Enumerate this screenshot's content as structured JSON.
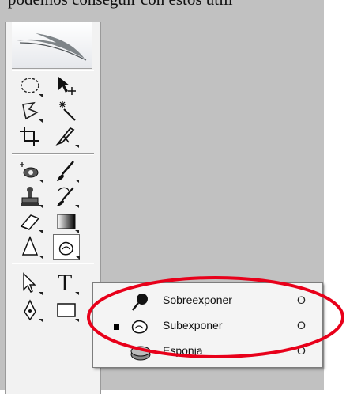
{
  "caption": "podemos conseguir con estos utili",
  "colors": {
    "workspace": "#c1c1c1",
    "toolbox": "#f2f2f2",
    "highlight_ellipse": "#e8001a"
  },
  "toolbox": {
    "tools": [
      "rectangular-marquee-icon",
      "move-icon",
      "lasso-icon",
      "magic-wand-icon",
      "crop-icon",
      "slice-icon",
      "spot-healing-icon",
      "brush-icon",
      "clone-stamp-icon",
      "history-brush-icon",
      "eraser-icon",
      "gradient-icon",
      "blur-icon",
      "dodge-icon",
      "path-selection-icon",
      "type-icon",
      "pen-icon",
      "rectangle-shape-icon"
    ],
    "type_tool_glyph": "T"
  },
  "flyout": {
    "items": [
      {
        "label": "Sobreexponer",
        "shortcut": "O",
        "icon": "dodge-icon",
        "selected": false
      },
      {
        "label": "Subexponer",
        "shortcut": "O",
        "icon": "burn-icon",
        "selected": true
      },
      {
        "label": "Esponja",
        "shortcut": "O",
        "icon": "sponge-icon",
        "selected": false
      }
    ]
  }
}
